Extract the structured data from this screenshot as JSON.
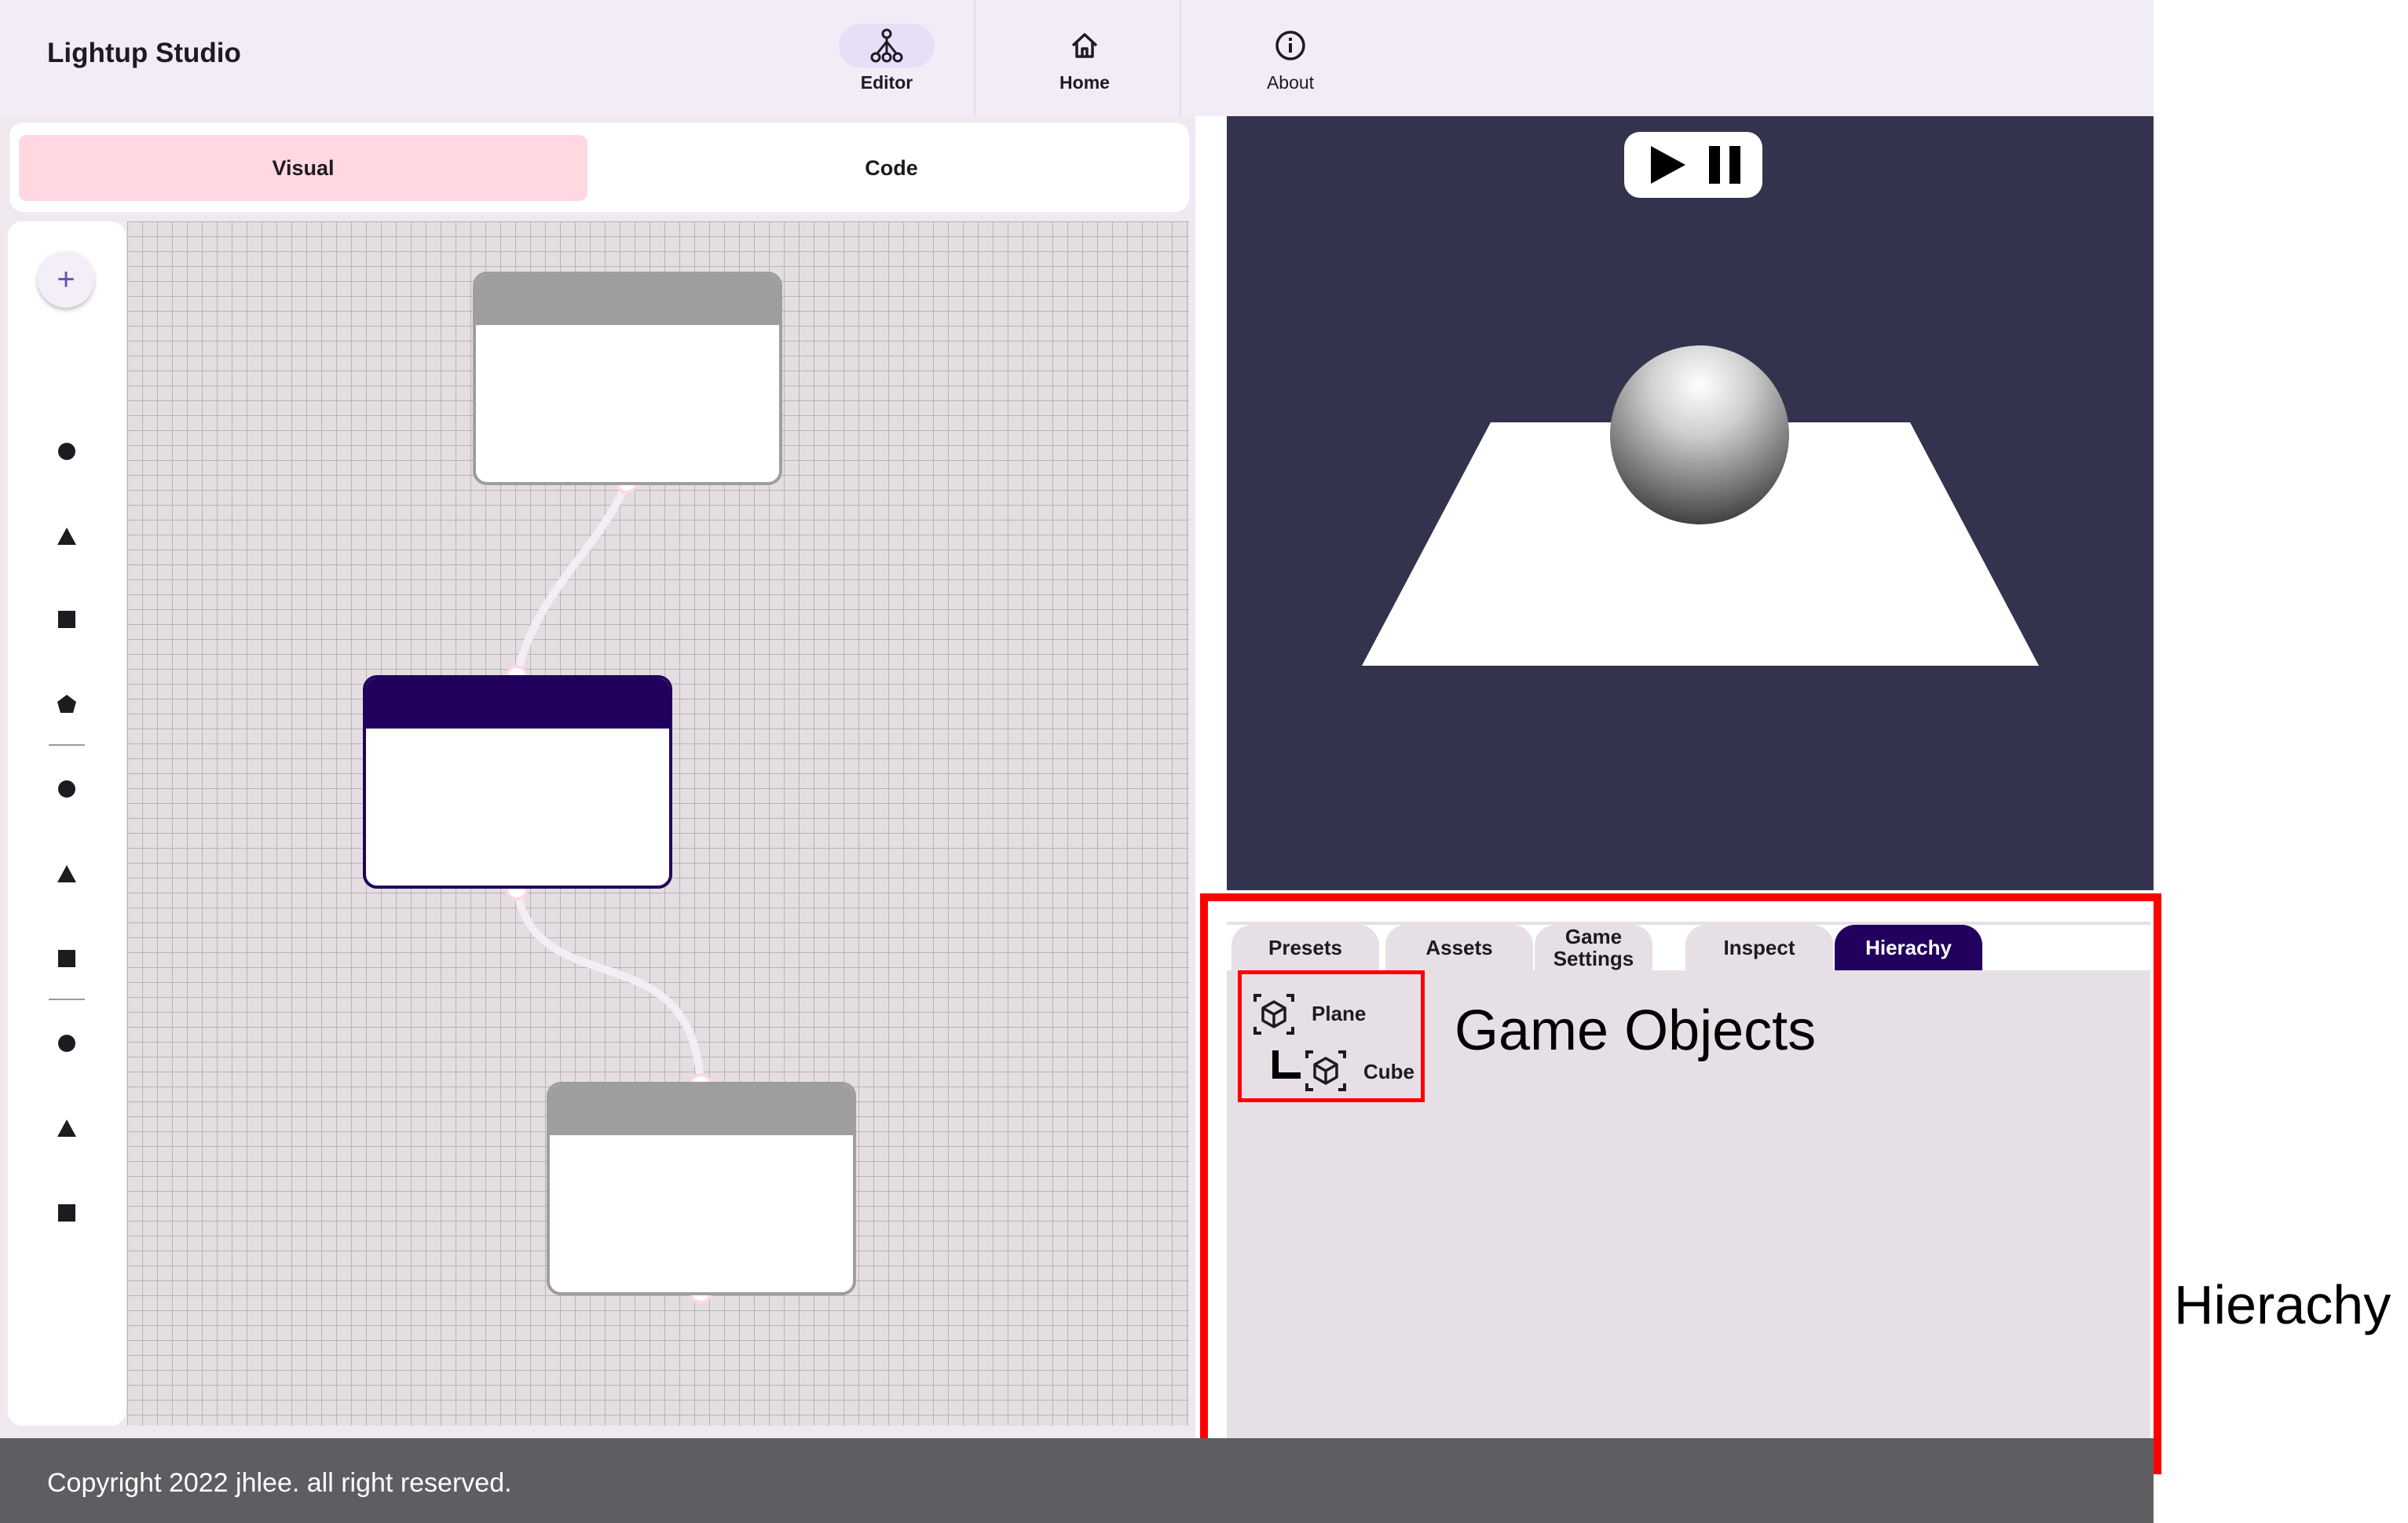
{
  "app": {
    "title": "Lightup Studio"
  },
  "nav": {
    "items": [
      {
        "label": "Editor",
        "icon": "tree-icon",
        "active": true
      },
      {
        "label": "Home",
        "icon": "home-icon",
        "active": false
      },
      {
        "label": "About",
        "icon": "info-icon",
        "active": false
      }
    ]
  },
  "editor": {
    "segments": [
      {
        "label": "Visual",
        "selected": true
      },
      {
        "label": "Code",
        "selected": false
      }
    ],
    "toolbar": {
      "add_icon": "plus-icon",
      "shape_icons": [
        "circle-icon",
        "triangle-icon",
        "square-icon",
        "pentagon-icon",
        "circle-icon",
        "triangle-icon",
        "square-icon",
        "circle-icon",
        "triangle-icon",
        "square-icon"
      ]
    }
  },
  "viewport": {
    "controls": [
      "play-icon",
      "pause-icon"
    ]
  },
  "panel": {
    "tabs": [
      "Presets",
      "Assets",
      "Game Settings",
      "Inspect",
      "Hierachy"
    ],
    "active_tab": "Hierachy",
    "objects": [
      {
        "label": "Plane",
        "icon": "cube-icon"
      },
      {
        "label": "Cube",
        "icon": "cube-icon",
        "child": true
      }
    ]
  },
  "annotations": {
    "objects_label": "Game Objects",
    "panel_label": "Hierachy",
    "color": "#ff0000"
  },
  "footer": {
    "copyright": "Copyright 2022 jhlee. all right reserved."
  },
  "colors": {
    "accent": "#21005e",
    "selected_segment": "#ffd8e2",
    "viewport_bg": "#33334d",
    "topbar": "#f2ecf7"
  }
}
